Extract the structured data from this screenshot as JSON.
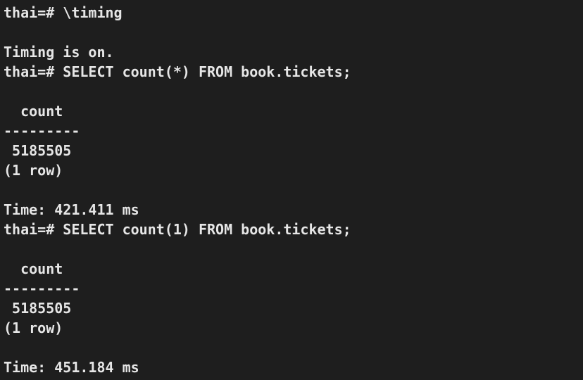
{
  "terminal": {
    "lines": [
      "thai=# \\timing",
      "",
      "Timing is on.",
      "thai=# SELECT count(*) FROM book.tickets;",
      "",
      "  count",
      "---------",
      " 5185505",
      "(1 row)",
      "",
      "Time: 421.411 ms",
      "thai=# SELECT count(1) FROM book.tickets;",
      "",
      "  count",
      "---------",
      " 5185505",
      "(1 row)",
      "",
      "Time: 451.184 ms"
    ]
  }
}
